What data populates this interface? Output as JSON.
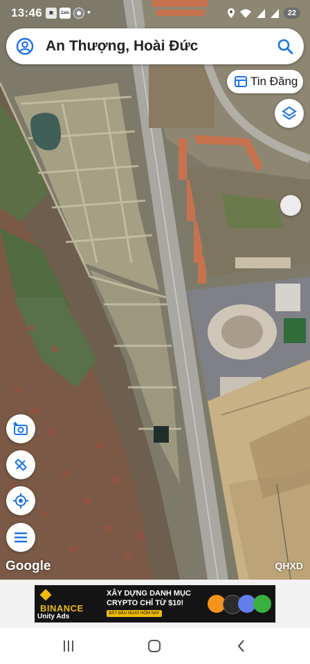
{
  "status_bar": {
    "time": "13:46",
    "apps": [
      "Zalo",
      "Chrome"
    ],
    "dot": "•",
    "battery": "22",
    "icons": [
      "location-icon",
      "wifi-icon",
      "signal-icon",
      "signal-icon",
      "battery-icon"
    ]
  },
  "search": {
    "location_text": "An Thượng, Hoài Đức",
    "icons": [
      "account-icon",
      "search-icon"
    ]
  },
  "listing_button": {
    "label": "Tin Đăng",
    "icon": "list-icon"
  },
  "map_controls": {
    "layers_icon": "layers-icon",
    "side_handle": "handle-icon",
    "left_buttons": [
      "camera-plus-icon",
      "ruler-icon",
      "my-location-icon",
      "menu-icon"
    ]
  },
  "map": {
    "watermark": "Google",
    "attribution": "QHXD",
    "accent_color": "#1a73e8"
  },
  "ad": {
    "brand": "BINANCE",
    "headline_line1": "XÂY DỰNG DANH MỤC",
    "headline_line2": "CRYPTO CHỈ TỪ $10!",
    "cta": "BẮT ĐẦU NGAY HÔM NAY",
    "network": "Unity Ads",
    "coin_colors": [
      "#f7931a",
      "#2b2b2b",
      "#627eea",
      "#3ab03e"
    ]
  },
  "nav_bar": {
    "buttons": [
      "recent-apps-icon",
      "home-icon",
      "back-icon"
    ]
  }
}
